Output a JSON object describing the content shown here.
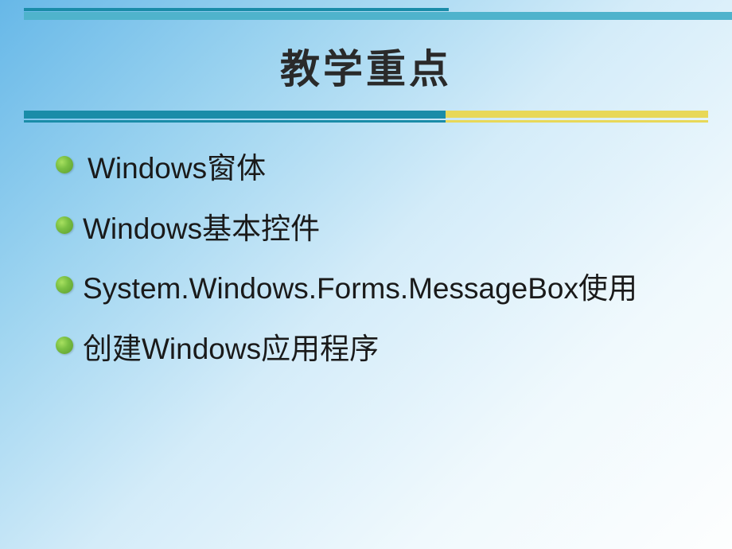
{
  "title": "教学重点",
  "bullets": [
    {
      "text": "Windows窗体"
    },
    {
      "text": "Windows基本控件"
    },
    {
      "text": "System.Windows.Forms.MessageBox使用"
    },
    {
      "text": "创建Windows应用程序"
    }
  ]
}
